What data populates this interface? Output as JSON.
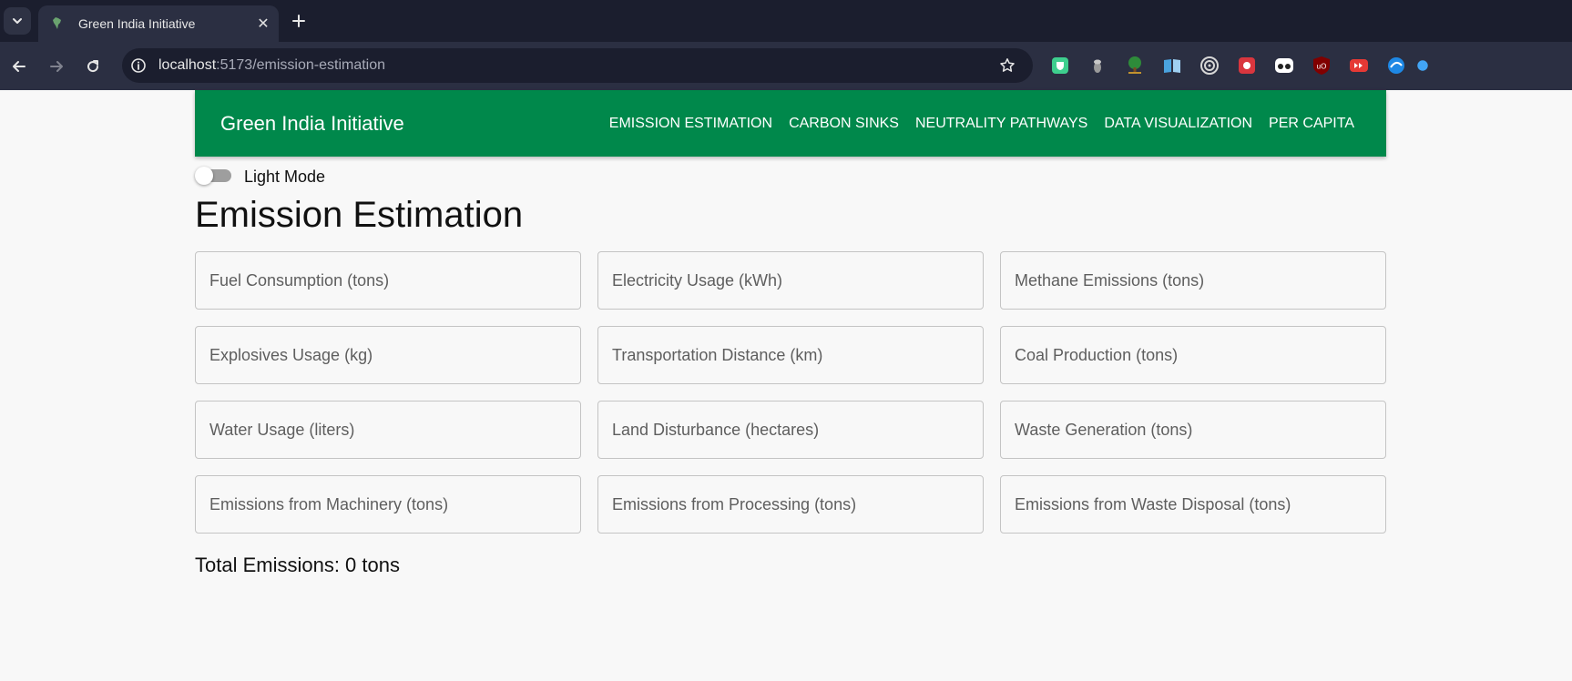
{
  "browser": {
    "tab_title": "Green India Initiative",
    "tab_close": "✕",
    "new_tab": "+",
    "url_host": "localhost",
    "url_rest": ":5173/emission-estimation"
  },
  "header": {
    "brand": "Green India Initiative",
    "nav": [
      "EMISSION ESTIMATION",
      "CARBON SINKS",
      "NEUTRALITY PATHWAYS",
      "DATA VISUALIZATION",
      "PER CAPITA"
    ]
  },
  "theme_toggle": {
    "label": "Light Mode",
    "checked": false
  },
  "page": {
    "title": "Emission Estimation"
  },
  "fields": [
    {
      "placeholder": "Fuel Consumption (tons)",
      "value": ""
    },
    {
      "placeholder": "Electricity Usage (kWh)",
      "value": ""
    },
    {
      "placeholder": "Methane Emissions (tons)",
      "value": ""
    },
    {
      "placeholder": "Explosives Usage (kg)",
      "value": ""
    },
    {
      "placeholder": "Transportation Distance (km)",
      "value": ""
    },
    {
      "placeholder": "Coal Production (tons)",
      "value": ""
    },
    {
      "placeholder": "Water Usage (liters)",
      "value": ""
    },
    {
      "placeholder": "Land Disturbance (hectares)",
      "value": ""
    },
    {
      "placeholder": "Waste Generation (tons)",
      "value": ""
    },
    {
      "placeholder": "Emissions from Machinery (tons)",
      "value": ""
    },
    {
      "placeholder": "Emissions from Processing (tons)",
      "value": ""
    },
    {
      "placeholder": "Emissions from Waste Disposal (tons)",
      "value": ""
    }
  ],
  "total": {
    "text": "Total Emissions: 0 tons"
  },
  "colors": {
    "appbar": "#00884b",
    "chrome_dark": "#1b1e2e",
    "chrome": "#2b2f42",
    "page_bg": "#f8f8f8"
  }
}
